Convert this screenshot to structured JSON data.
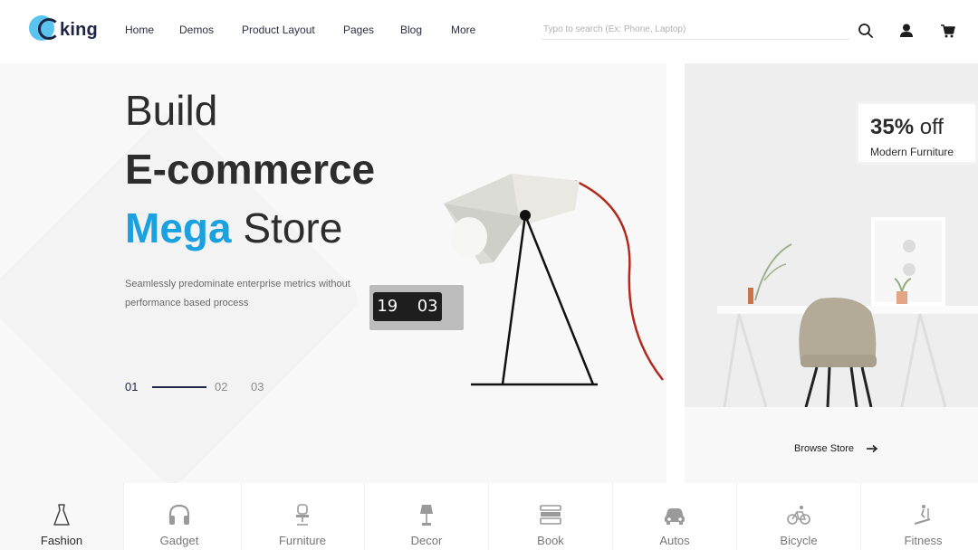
{
  "brand": {
    "logo_text": "king",
    "accent": "#1ba1e0",
    "dark": "#1d2546"
  },
  "nav": [
    "Home",
    "Demos",
    "Product Layout",
    "Pages",
    "Blog",
    "More"
  ],
  "search": {
    "placeholder": "Typo to search (Ex: Phone, Laptop)"
  },
  "header_icons": [
    "search-icon",
    "user-icon",
    "cart-icon"
  ],
  "hero": {
    "line1": "Build",
    "line2": "E-commerce",
    "line3_accent": "Mega",
    "line3_rest": "Store",
    "subtitle": "Seamlessly predominate enterprise metrics without performance based process",
    "pager": [
      "01",
      "02",
      "03"
    ],
    "clock_hours": "19",
    "clock_minutes": "03"
  },
  "promo": {
    "percent": "35%",
    "off_word": "off",
    "subtitle": "Modern Furniture",
    "cta": "Browse Store"
  },
  "categories": [
    {
      "label": "Fashion",
      "icon": "dress-icon"
    },
    {
      "label": "Gadget",
      "icon": "headphones-icon"
    },
    {
      "label": "Furniture",
      "icon": "office-chair-icon"
    },
    {
      "label": "Decor",
      "icon": "lamp-icon"
    },
    {
      "label": "Book",
      "icon": "books-icon"
    },
    {
      "label": "Autos",
      "icon": "car-icon"
    },
    {
      "label": "Bicycle",
      "icon": "bicycle-icon"
    },
    {
      "label": "Fitness",
      "icon": "treadmill-icon"
    }
  ]
}
